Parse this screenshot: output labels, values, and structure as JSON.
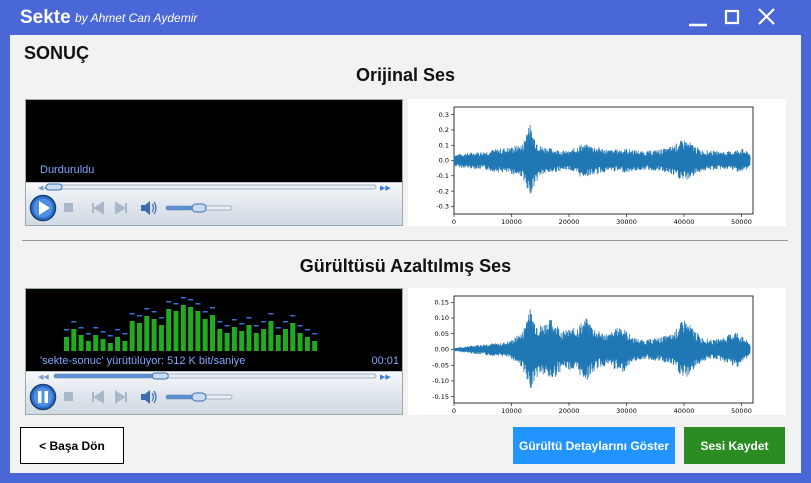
{
  "window": {
    "app_name": "Sekte",
    "author": "by Ahmet Can Aydemir"
  },
  "main": {
    "result_title": "SONUÇ",
    "original": {
      "title": "Orijinal Ses",
      "player_status": "Durduruldu",
      "player_time": "",
      "playing": false,
      "seek_fraction": 0.0,
      "volume_fraction": 0.5
    },
    "denoised": {
      "title": "Gürültüsü Azaltılmış Ses",
      "player_status": "'sekte-sonuc' yürütülüyor: 512 K bit/saniye",
      "player_time": "00:01",
      "playing": true,
      "seek_fraction": 0.33,
      "volume_fraction": 0.5
    }
  },
  "chart_data": [
    {
      "type": "line",
      "title": "",
      "xlabel": "",
      "ylabel": "",
      "xlim": [
        0,
        52000
      ],
      "ylim": [
        -0.35,
        0.35
      ],
      "x_ticks": [
        "0",
        "10000",
        "20000",
        "30000",
        "40000",
        "50000"
      ],
      "y_ticks": [
        "0.3",
        "0.2",
        "0.1",
        "0.0",
        "-0.1",
        "-0.2",
        "-0.3"
      ],
      "color": "#1f77b4",
      "envelope": [
        [
          0,
          0.04
        ],
        [
          2000,
          0.05
        ],
        [
          5000,
          0.06
        ],
        [
          8000,
          0.08
        ],
        [
          10000,
          0.09
        ],
        [
          12000,
          0.11
        ],
        [
          13000,
          0.27
        ],
        [
          13500,
          0.2
        ],
        [
          15000,
          0.1
        ],
        [
          17000,
          0.08
        ],
        [
          20000,
          0.06
        ],
        [
          22000,
          0.11
        ],
        [
          24000,
          0.1
        ],
        [
          27000,
          0.07
        ],
        [
          30000,
          0.08
        ],
        [
          33000,
          0.06
        ],
        [
          35000,
          0.07
        ],
        [
          37000,
          0.08
        ],
        [
          40000,
          0.14
        ],
        [
          41000,
          0.12
        ],
        [
          43000,
          0.07
        ],
        [
          46000,
          0.06
        ],
        [
          48000,
          0.06
        ],
        [
          50000,
          0.08
        ],
        [
          51500,
          0.05
        ]
      ]
    },
    {
      "type": "line",
      "title": "",
      "xlabel": "",
      "ylabel": "",
      "xlim": [
        0,
        52000
      ],
      "ylim": [
        -0.17,
        0.17
      ],
      "x_ticks": [
        "0",
        "10000",
        "20000",
        "30000",
        "40000",
        "50000"
      ],
      "y_ticks": [
        "0.15",
        "0.10",
        "0.05",
        "0.00",
        "-0.05",
        "-0.10",
        "-0.15"
      ],
      "color": "#1f77b4",
      "envelope": [
        [
          0,
          0.005
        ],
        [
          2000,
          0.01
        ],
        [
          4000,
          0.015
        ],
        [
          6000,
          0.02
        ],
        [
          8000,
          0.02
        ],
        [
          10000,
          0.03
        ],
        [
          12000,
          0.06
        ],
        [
          13000,
          0.14
        ],
        [
          14000,
          0.1
        ],
        [
          15000,
          0.08
        ],
        [
          17000,
          0.1
        ],
        [
          19000,
          0.06
        ],
        [
          21000,
          0.07
        ],
        [
          23000,
          0.1
        ],
        [
          25000,
          0.06
        ],
        [
          27000,
          0.05
        ],
        [
          29000,
          0.08
        ],
        [
          31000,
          0.04
        ],
        [
          33000,
          0.03
        ],
        [
          36000,
          0.04
        ],
        [
          38000,
          0.05
        ],
        [
          40000,
          0.1
        ],
        [
          41000,
          0.08
        ],
        [
          43000,
          0.04
        ],
        [
          45000,
          0.03
        ],
        [
          47000,
          0.04
        ],
        [
          49000,
          0.06
        ],
        [
          51500,
          0.02
        ]
      ]
    }
  ],
  "buttons": {
    "back": "< Başa Dön",
    "details": "Gürültü Detaylarını Göster",
    "save": "Sesi Kaydet"
  },
  "colors": {
    "title_bar": "#4a67d7",
    "details_button": "#2194ff",
    "save_button": "#2a8c22",
    "visualizer": "#22aa22",
    "player_text": "#7fa6ff"
  }
}
